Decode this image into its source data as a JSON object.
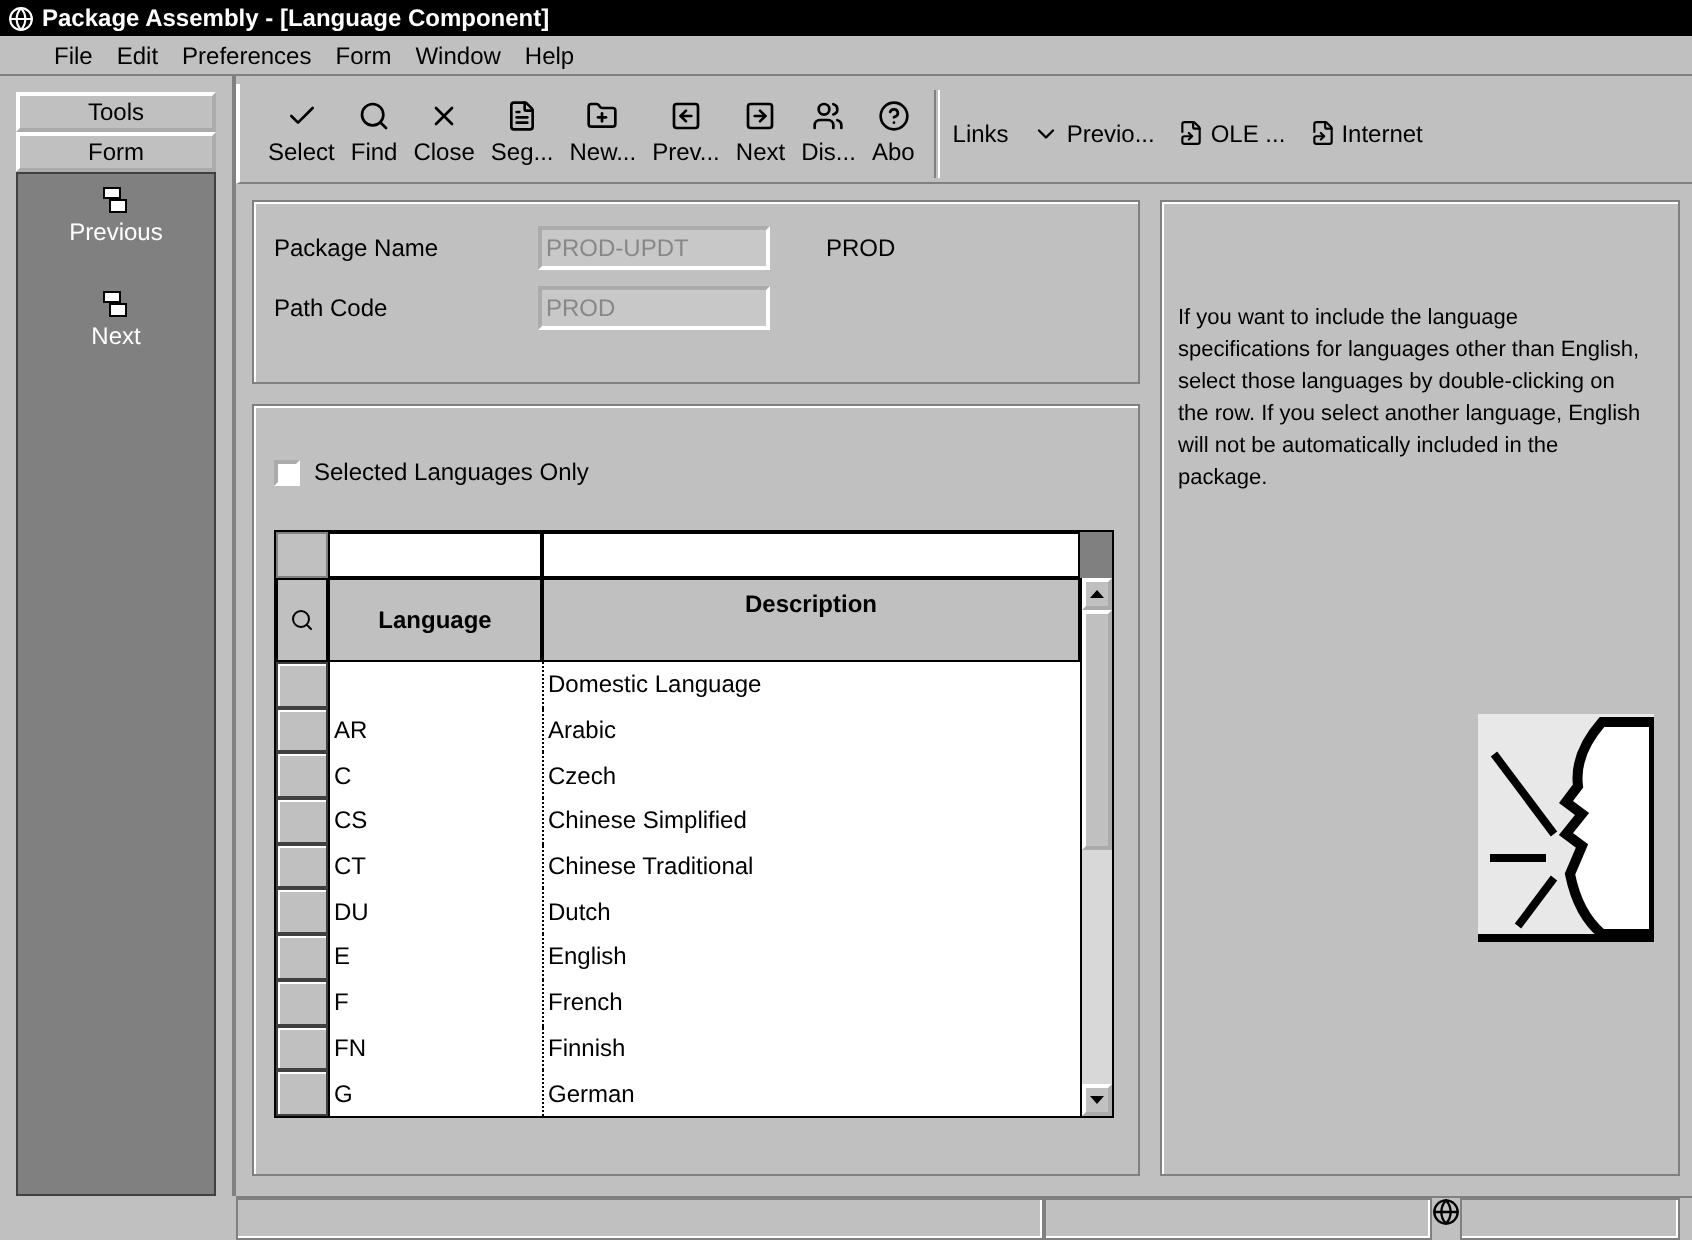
{
  "window": {
    "title": "Package Assembly - [Language Component]"
  },
  "menu": [
    "File",
    "Edit",
    "Preferences",
    "Form",
    "Window",
    "Help"
  ],
  "sidebar": {
    "tabs": [
      "Tools",
      "Form"
    ],
    "items": [
      {
        "label": "Previous"
      },
      {
        "label": "Next"
      }
    ]
  },
  "toolbar": [
    {
      "label": "Select"
    },
    {
      "label": "Find"
    },
    {
      "label": "Close"
    },
    {
      "label": "Seg..."
    },
    {
      "label": "New..."
    },
    {
      "label": "Prev..."
    },
    {
      "label": "Next"
    },
    {
      "label": "Dis..."
    },
    {
      "label": "Abo"
    }
  ],
  "links": {
    "label": "Links",
    "items": [
      "Previo...",
      "OLE ...",
      "Internet"
    ]
  },
  "form": {
    "fields": [
      {
        "label": "Package Name",
        "value": "PROD-UPDT",
        "note": "PROD"
      },
      {
        "label": "Path Code",
        "value": "PROD"
      }
    ]
  },
  "filter": {
    "label": "Selected Languages Only",
    "checked": false
  },
  "table": {
    "columns": [
      "Language",
      "Description"
    ],
    "rows": [
      {
        "language": "",
        "description": "Domestic Language"
      },
      {
        "language": "AR",
        "description": "Arabic"
      },
      {
        "language": "C",
        "description": "Czech"
      },
      {
        "language": "CS",
        "description": "Chinese Simplified"
      },
      {
        "language": "CT",
        "description": "Chinese Traditional"
      },
      {
        "language": "DU",
        "description": "Dutch"
      },
      {
        "language": "E",
        "description": "English"
      },
      {
        "language": "F",
        "description": "French"
      },
      {
        "language": "FN",
        "description": "Finnish"
      },
      {
        "language": "G",
        "description": "German"
      }
    ]
  },
  "help": {
    "text": "If you want  to include the language specifications for languages other than English, select those languages by double-clicking on the  row. If you select another language, English will not be automatically included in the package."
  }
}
